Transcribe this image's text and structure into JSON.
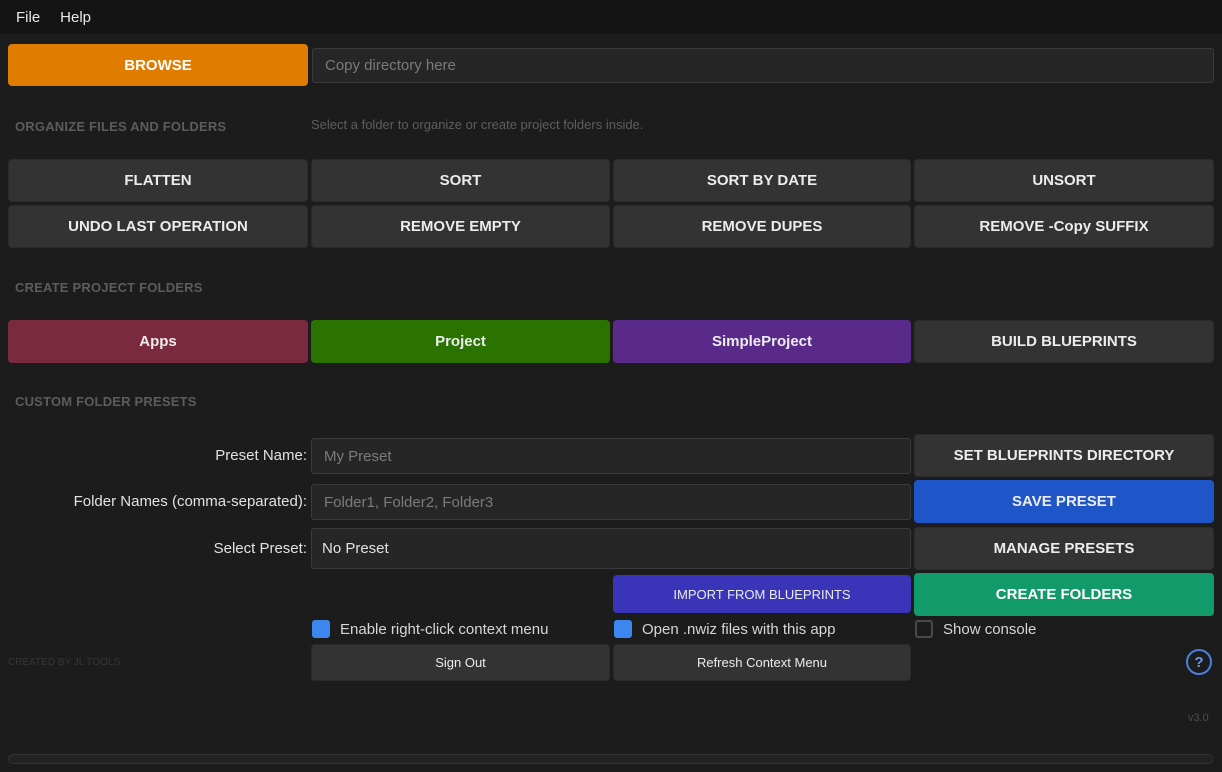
{
  "menu": {
    "file": "File",
    "help": "Help"
  },
  "browse": {
    "label": "BROWSE",
    "placeholder": "Copy directory here",
    "value": ""
  },
  "organize": {
    "title": "ORGANIZE FILES AND FOLDERS",
    "hint": "Select a folder to organize or create project folders inside.",
    "buttons": {
      "flatten": "FLATTEN",
      "sort": "SORT",
      "sort_by_date": "SORT BY DATE",
      "unsort": "UNSORT",
      "undo": "UNDO LAST OPERATION",
      "remove_empty": "REMOVE EMPTY",
      "remove_dupes": "REMOVE DUPES",
      "remove_copy_suffix": "REMOVE -Copy SUFFIX"
    }
  },
  "project": {
    "title": "CREATE PROJECT FOLDERS",
    "buttons": {
      "apps": "Apps",
      "project": "Project",
      "simple_project": "SimpleProject",
      "build_blueprints": "BUILD BLUEPRINTS"
    }
  },
  "presets": {
    "title": "CUSTOM FOLDER PRESETS",
    "preset_name_label": "Preset Name:",
    "preset_name_placeholder": "My Preset",
    "folder_names_label": "Folder Names (comma-separated):",
    "folder_names_placeholder": "Folder1, Folder2, Folder3",
    "select_preset_label": "Select Preset:",
    "select_preset_value": "No Preset",
    "buttons": {
      "set_blueprints_dir": "SET BLUEPRINTS DIRECTORY",
      "save_preset": "SAVE PRESET",
      "manage_presets": "MANAGE PRESETS",
      "import_blueprints": "IMPORT FROM BLUEPRINTS",
      "create_folders": "CREATE FOLDERS"
    }
  },
  "options": {
    "context_menu": {
      "label": "Enable right-click context menu",
      "checked": true
    },
    "nwiz_files": {
      "label": "Open .nwiz files with this app",
      "checked": true
    },
    "show_console": {
      "label": "Show console",
      "checked": false
    }
  },
  "footer": {
    "sign_out": "Sign Out",
    "refresh_context": "Refresh Context Menu",
    "credit": "CREATED BY JL TOOLS",
    "help": "?",
    "version": "v3.0",
    "progress": 0
  },
  "colors": {
    "browse": "#e07d00",
    "apps": "#7a2a3f",
    "project": "#2a7300",
    "simple_project": "#5a2a8a",
    "save_preset": "#1e55c8",
    "import_blueprints": "#3a34b8",
    "create_folders": "#139a6a",
    "checkbox_on": "#3d86f0"
  }
}
